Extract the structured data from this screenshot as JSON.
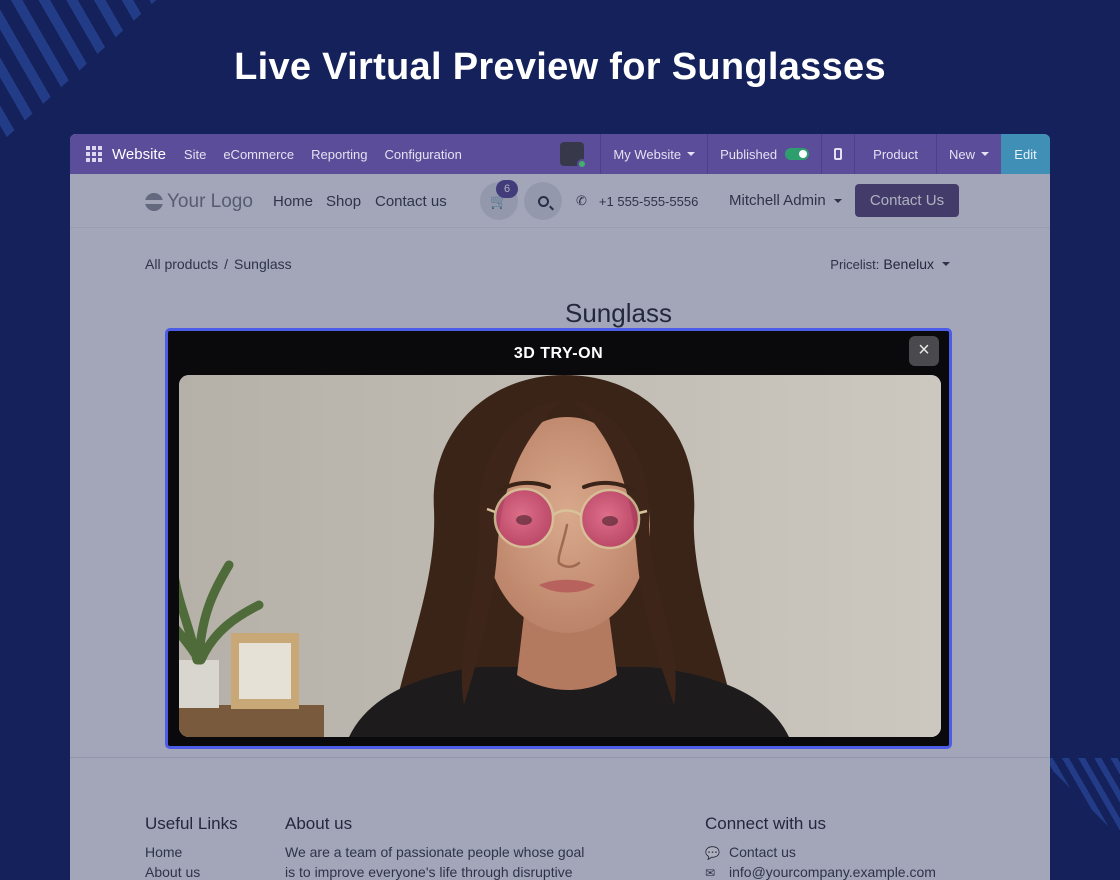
{
  "headline": "Live Virtual Preview for Sunglasses",
  "odoo_bar": {
    "app_name": "Website",
    "menus": [
      "Site",
      "eCommerce",
      "Reporting",
      "Configuration"
    ],
    "website_selector": "My Website",
    "published_label": "Published",
    "published": true,
    "product_label": "Product",
    "new_label": "New",
    "edit_label": "Edit"
  },
  "site_nav": {
    "logo_text": "Your Logo",
    "links": [
      "Home",
      "Shop",
      "Contact us"
    ],
    "cart_count": "6",
    "phone": "+1 555-555-5556",
    "user": "Mitchell Admin",
    "contact_button": "Contact Us"
  },
  "breadcrumb": {
    "root": "All products",
    "separator": "/",
    "current": "Sunglass"
  },
  "pricelist": {
    "label": "Pricelist:",
    "value": "Benelux"
  },
  "product": {
    "title": "Sunglass"
  },
  "modal": {
    "title": "3D TRY-ON",
    "close_symbol": "×"
  },
  "footer": {
    "useful_links": {
      "title": "Useful Links",
      "items": [
        "Home",
        "About us"
      ]
    },
    "about": {
      "title": "About us",
      "line1": "We are a team of passionate people whose goal",
      "line2": "is to improve everyone's life through disruptive"
    },
    "connect": {
      "title": "Connect with us",
      "contact": "Contact us",
      "email": "info@yourcompany.example.com"
    }
  },
  "colors": {
    "page_bg": "#14215a",
    "odoo_purple": "#5b4d99",
    "modal_border": "#4d5ce6",
    "lens_tint": "#d2496f"
  }
}
